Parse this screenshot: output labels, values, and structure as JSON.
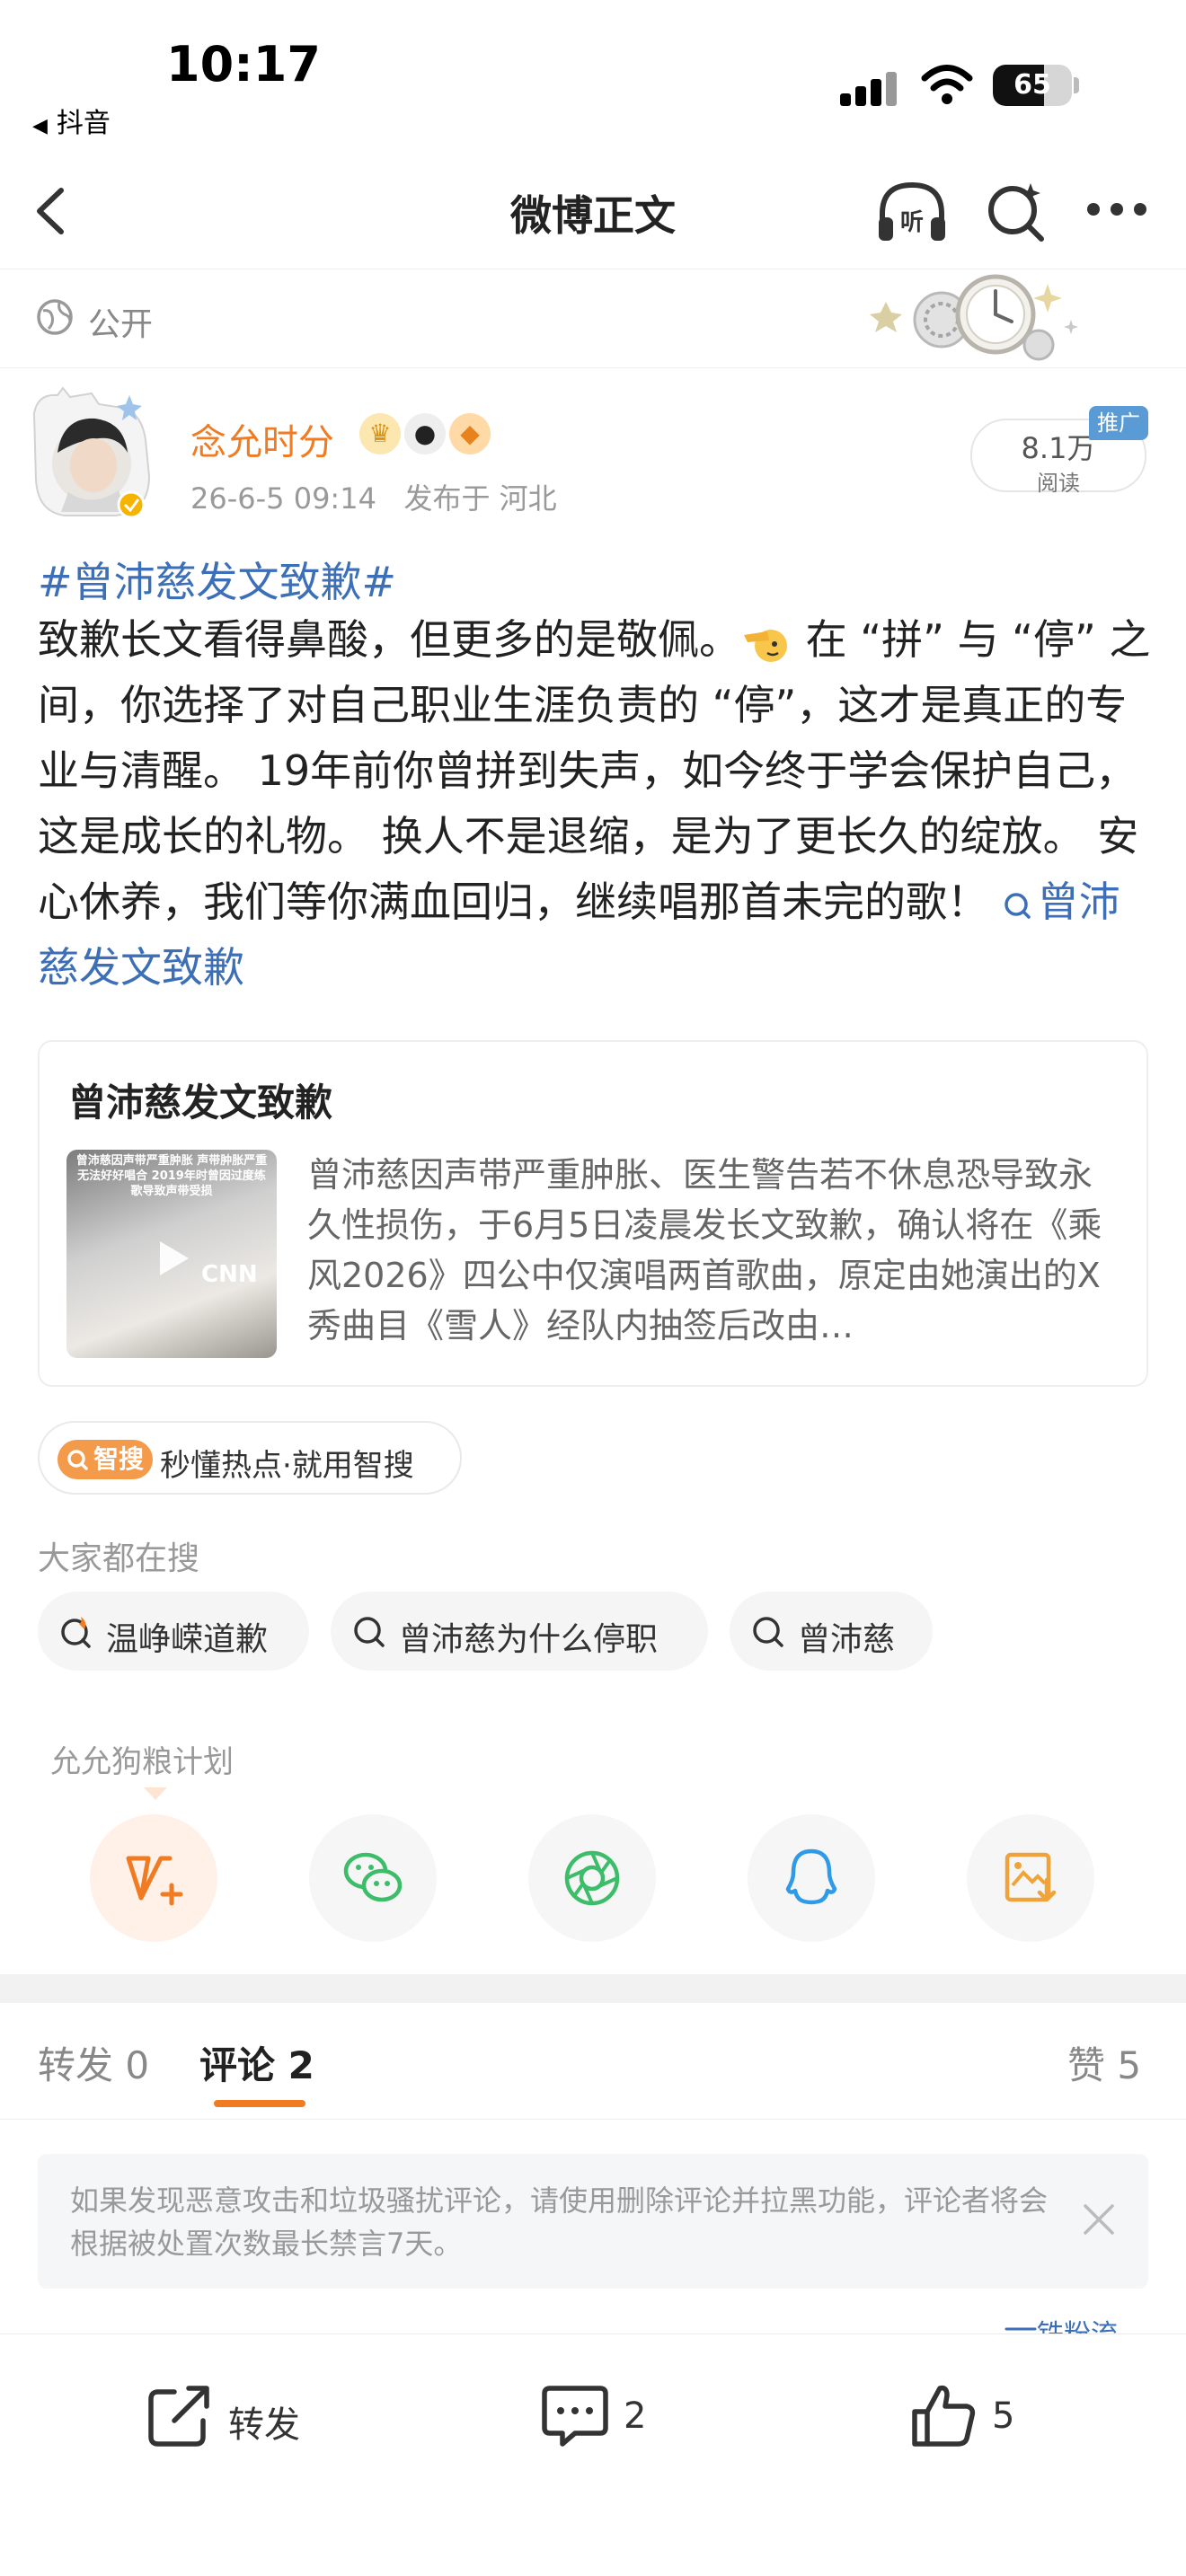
{
  "status_bar": {
    "time": "10:17",
    "back_app": "抖音",
    "battery": "65",
    "battery_level": 0.65
  },
  "nav": {
    "title": "微博正文"
  },
  "visibility": {
    "label": "公开"
  },
  "author": {
    "name": "念允时分",
    "timestamp": "26-6-5 09:14",
    "location": "发布于 河北",
    "read_count": "8.1万",
    "read_label": "阅读",
    "promo_tag": "推广"
  },
  "post": {
    "hashtag": "#曾沛慈发文致歉#",
    "text_1": "致歉长文看得鼻酸，但更多的是敬佩。",
    "text_2": " 在 “拼” 与 “停” 之间，你选择了对自己职业生涯负责的 “停”，这才是真正的专业与清醒。 19年前你曾拼到失声，如今终于学会保护自己，这是成长的礼物。 换人不是退缩，是为了更长久的绽放。 安心休养，我们等你满血回归，继续唱那首未完的歌！ ",
    "link_text": "曾沛慈发文致歉"
  },
  "news_card": {
    "title": "曾沛慈发文致歉",
    "thumb_caption": "曾沛慈因声带严重肿胀 声带肿胀严重 无法好好唱合 2019年时曾因过度练歌导致声带受损",
    "thumb_logo": "CNN",
    "summary": "曾沛慈因声带严重肿胀、医生警告若不休息恐导致永久性损伤，于6月5日凌晨发长文致歉，确认将在《乘风2026》四公中仅演唱两首歌曲，原定由她演出的X秀曲目《雪人》经队内抽签后改由…"
  },
  "smart_search": {
    "logo": "智搜",
    "text": "秒懂热点·就用智搜"
  },
  "everyone_searching": {
    "label": "大家都在搜",
    "chips": [
      "温峥嵘道歉",
      "曾沛慈为什么停职",
      "曾沛慈"
    ]
  },
  "share": {
    "label": "允允狗粮计划",
    "icons": [
      "weibo-plus-icon",
      "wechat-icon",
      "moments-icon",
      "qq-icon",
      "save-image-icon"
    ]
  },
  "tabs": {
    "repost_label": "转发",
    "repost_count": "0",
    "comment_label": "评论",
    "comment_count": "2",
    "like_label": "赞",
    "like_count": "5"
  },
  "notice": {
    "text": "如果发现恶意攻击和垃圾骚扰评论，请使用删除评论并拉黑功能，评论者将会根据被处置次数最长禁言7天。"
  },
  "fan_list": {
    "label": "铁粉流"
  },
  "bottom_bar": {
    "repost_label": "转发",
    "comment_count": "2",
    "like_count": "5"
  },
  "colors": {
    "accent_orange": "#f07b22",
    "link_blue": "#3c6fb8",
    "promo_blue": "#5b9bd5"
  }
}
